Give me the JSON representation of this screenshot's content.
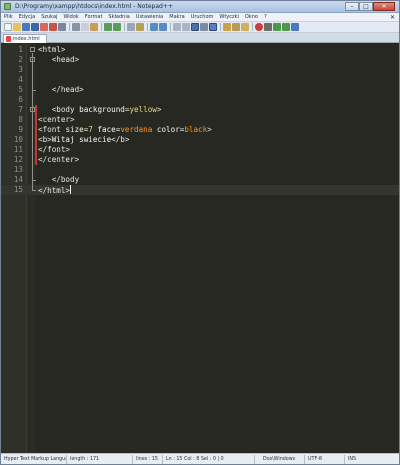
{
  "window": {
    "title": "D:\\Programy\\xampp\\htdocs\\index.html - Notepad++"
  },
  "menu": [
    "Plik",
    "Edycja",
    "Szukaj",
    "Widok",
    "Format",
    "Składnia",
    "Ustawienia",
    "Makra",
    "Uruchom",
    "Wtyczki",
    "Okno",
    "?"
  ],
  "tabs": [
    {
      "label": "index.html"
    }
  ],
  "editor": {
    "lines": [
      {
        "n": "1",
        "parts": [
          [
            "tag",
            "<html>"
          ]
        ]
      },
      {
        "n": "2",
        "parts": [
          [
            "txt",
            "   "
          ],
          [
            "tag",
            "<head>"
          ]
        ]
      },
      {
        "n": "3",
        "parts": []
      },
      {
        "n": "4",
        "parts": []
      },
      {
        "n": "5",
        "parts": [
          [
            "txt",
            "   "
          ],
          [
            "tag",
            "</head>"
          ]
        ]
      },
      {
        "n": "6",
        "parts": []
      },
      {
        "n": "7",
        "parts": [
          [
            "txt",
            "   "
          ],
          [
            "tag",
            "<body "
          ],
          [
            "attr",
            "background="
          ],
          [
            "val",
            "yellow"
          ],
          [
            "tag",
            ">"
          ]
        ]
      },
      {
        "n": "8",
        "parts": [
          [
            "tag",
            "<center>"
          ]
        ]
      },
      {
        "n": "9",
        "parts": [
          [
            "tag",
            "<font "
          ],
          [
            "attr",
            "size="
          ],
          [
            "val",
            "7"
          ],
          [
            "tag",
            " "
          ],
          [
            "attr",
            "face="
          ],
          [
            "val-or",
            "verdana"
          ],
          [
            "tag",
            " "
          ],
          [
            "attr",
            "color="
          ],
          [
            "val-or",
            "black"
          ],
          [
            "tag",
            ">"
          ]
        ]
      },
      {
        "n": "10",
        "parts": [
          [
            "tag",
            "<b>"
          ],
          [
            "txt",
            "Witaj swiecie"
          ],
          [
            "tag",
            "</b>"
          ]
        ]
      },
      {
        "n": "11",
        "parts": [
          [
            "tag",
            "</font>"
          ]
        ]
      },
      {
        "n": "12",
        "parts": [
          [
            "tag",
            "</center>"
          ]
        ]
      },
      {
        "n": "13",
        "parts": []
      },
      {
        "n": "14",
        "parts": [
          [
            "txt",
            "   "
          ],
          [
            "tag",
            "</body"
          ]
        ]
      },
      {
        "n": "15",
        "parts": [
          [
            "tag",
            "</html>"
          ]
        ]
      }
    ],
    "current_line": "15"
  },
  "status": {
    "file_type": "Hyper Text Markup Language file",
    "length": "length : 171",
    "lines": "lines : 15",
    "position": "Ln : 15    Col : 8    Sel : 0 | 0",
    "eol": "Dos\\Windows",
    "encoding": "UTF-8",
    "mode": "INS"
  },
  "colors": {
    "editor_bg": "#272822",
    "tag": "#e7e7e7",
    "value": "#e6db74",
    "value_alt": "#fd971f"
  }
}
